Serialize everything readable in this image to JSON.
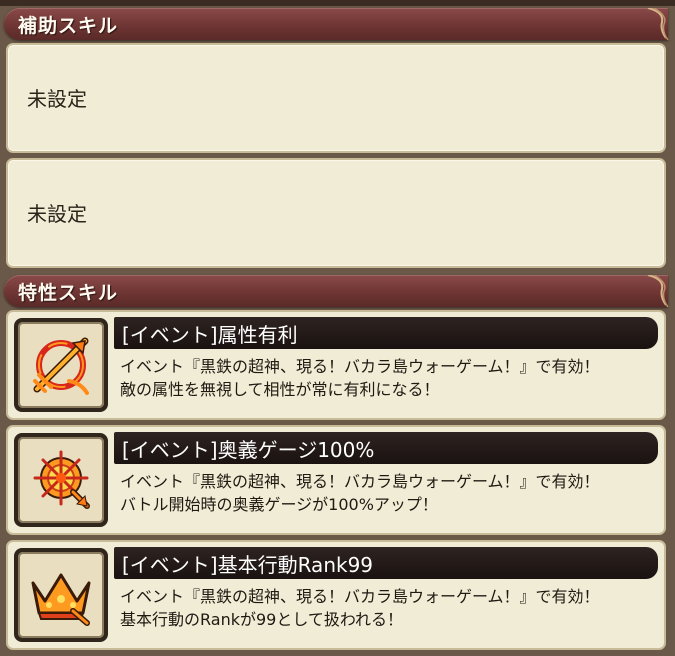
{
  "support_section": {
    "title": "補助スキル",
    "slots": [
      {
        "text": "未設定"
      },
      {
        "text": "未設定"
      }
    ]
  },
  "trait_section": {
    "title": "特性スキル",
    "skills": [
      {
        "icon": "attribute-advantage-icon",
        "name": "[イベント]属性有利",
        "desc_line1": "イベント『黒鉄の超神、現る！バカラ島ウォーゲーム！』で有効！",
        "desc_line2": "敵の属性を無視して相性が常に有利になる！"
      },
      {
        "icon": "ougi-gauge-icon",
        "name": "[イベント]奥義ゲージ100%",
        "desc_line1": "イベント『黒鉄の超神、現る！バカラ島ウォーゲーム！』で有効！",
        "desc_line2": "バトル開始時の奥義ゲージが100%アップ！"
      },
      {
        "icon": "crown-rank-icon",
        "name": "[イベント]基本行動Rank99",
        "desc_line1": "イベント『黒鉄の超神、現る！バカラ島ウォーゲーム！』で有効！",
        "desc_line2": "基本行動のRankが99として扱われる！"
      }
    ]
  },
  "colors": {
    "header": "#6c3432",
    "panel": "#f1ecd6",
    "name_bar": "#1a1210",
    "icon_accent": "#f08a18"
  }
}
